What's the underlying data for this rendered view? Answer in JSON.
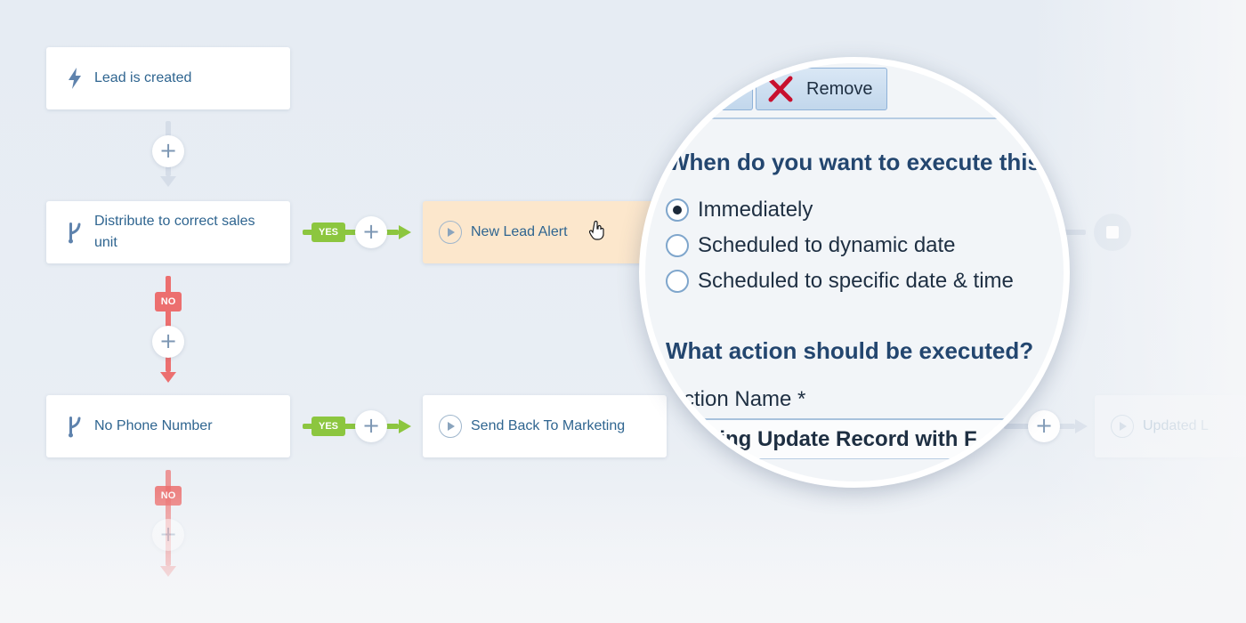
{
  "workflow": {
    "trigger": {
      "label": "Lead is created",
      "icon": "lightning-icon"
    },
    "branch1": {
      "label": "Distribute to correct sales unit",
      "icon": "branch-icon"
    },
    "branch2": {
      "label": "No Phone Number",
      "icon": "branch-icon"
    },
    "action1": {
      "label": "New Lead Alert",
      "icon": "play-icon"
    },
    "action2": {
      "label": "Send Back To Marketing",
      "icon": "play-icon"
    },
    "action3": {
      "label": "Updated L",
      "icon": "play-icon"
    },
    "yes_label": "YES",
    "no_label": "NO",
    "plus_symbol": "+"
  },
  "magnifier": {
    "remove_label": "Remove",
    "heading1": "When do you want to execute this a",
    "options": [
      {
        "label": "Immediately",
        "checked": true
      },
      {
        "label": "Scheduled to dynamic date",
        "checked": false
      },
      {
        "label": "Scheduled to specific date & time",
        "checked": false
      }
    ],
    "heading2": "What action should be executed?",
    "action_name_label": "ction Name *",
    "action_name_value": "eting Update Record with F"
  },
  "colors": {
    "accent_text": "#2f6590",
    "yes_green": "#8cc63f",
    "no_red": "#ec6f6f",
    "highlight_node": "#fce7cc"
  }
}
